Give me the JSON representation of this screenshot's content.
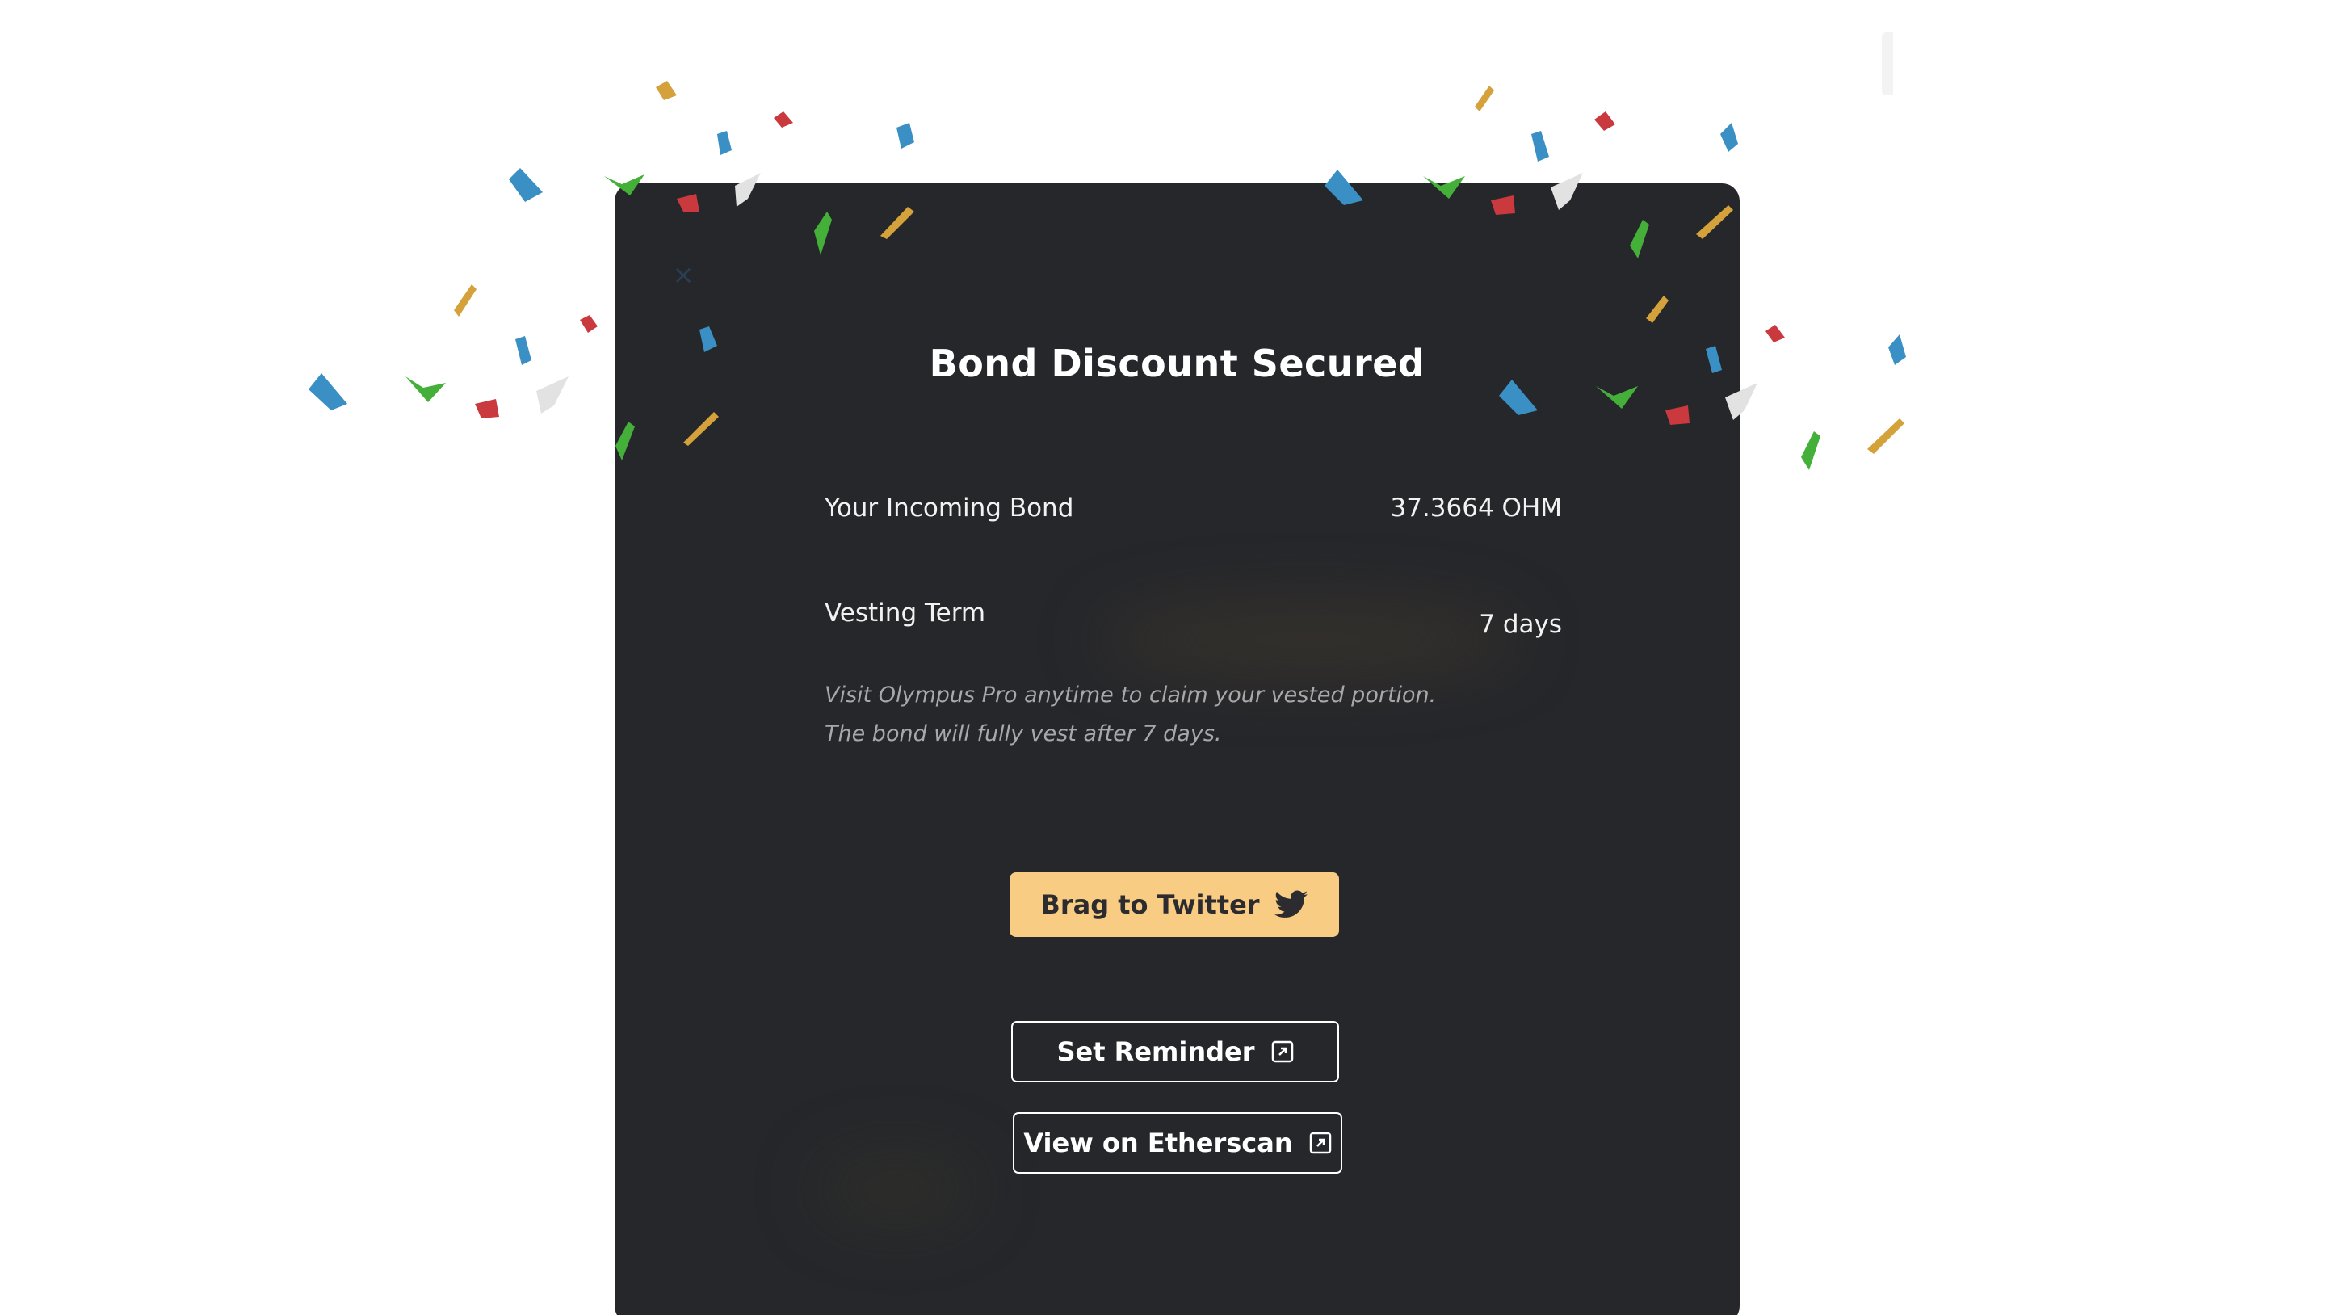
{
  "modal": {
    "close_label": "×",
    "title": "Bond Discount Secured",
    "rows": [
      {
        "label": "Your Incoming Bond",
        "value": "37.3664 OHM"
      },
      {
        "label": "Vesting Term",
        "value": "7 days"
      }
    ],
    "notes": [
      "Visit Olympus Pro anytime to claim your vested portion.",
      "The bond will fully vest after 7 days."
    ],
    "buttons": {
      "twitter": {
        "label": "Brag to Twitter",
        "icon": "twitter-bird-icon"
      },
      "reminder": {
        "label": "Set Reminder",
        "icon": "external-link-icon"
      },
      "etherscan": {
        "label": "View on Etherscan",
        "icon": "external-link-icon"
      }
    }
  },
  "colors": {
    "modal_bg": "#26272b",
    "accent": "#f8cc82",
    "text": "#ffffff",
    "note_text": "#a8a8ac",
    "confetti": [
      "#3a8fc4",
      "#d4a13a",
      "#c9393d",
      "#44b03a",
      "#e2e2e2"
    ]
  }
}
